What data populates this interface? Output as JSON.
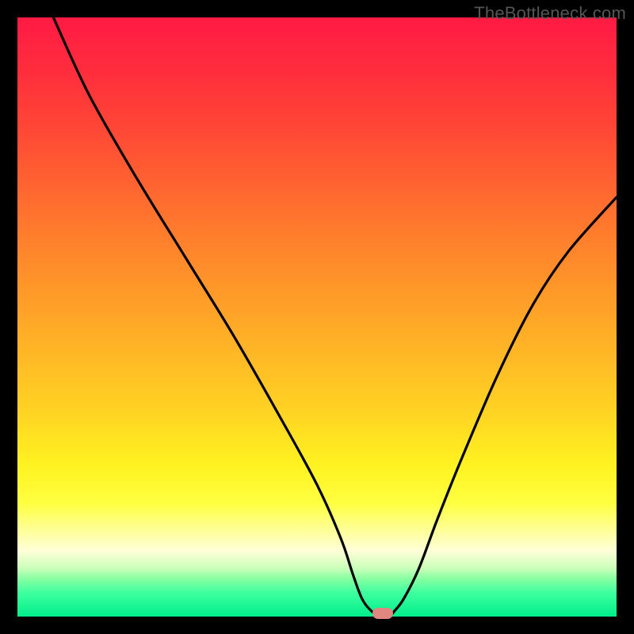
{
  "watermark": "TheBottleneck.com",
  "colors": {
    "curve": "#000000",
    "marker": "#e08880"
  },
  "chart_data": {
    "type": "line",
    "title": "",
    "xlabel": "",
    "ylabel": "",
    "xlim": [
      0,
      100
    ],
    "ylim": [
      0,
      100
    ],
    "series": [
      {
        "name": "curve",
        "x": [
          6,
          12,
          20,
          28,
          36,
          44,
          50,
          54,
          56,
          57.5,
          59,
          60.5,
          62,
          63,
          64.5,
          67,
          70,
          74,
          80,
          86,
          92,
          100
        ],
        "y": [
          100,
          87,
          73,
          60,
          47,
          33,
          22,
          13,
          7,
          3,
          1,
          0,
          0,
          1,
          3,
          8,
          16,
          26,
          40,
          52,
          61,
          70
        ]
      }
    ],
    "marker": {
      "x": 61,
      "y": 0
    }
  }
}
